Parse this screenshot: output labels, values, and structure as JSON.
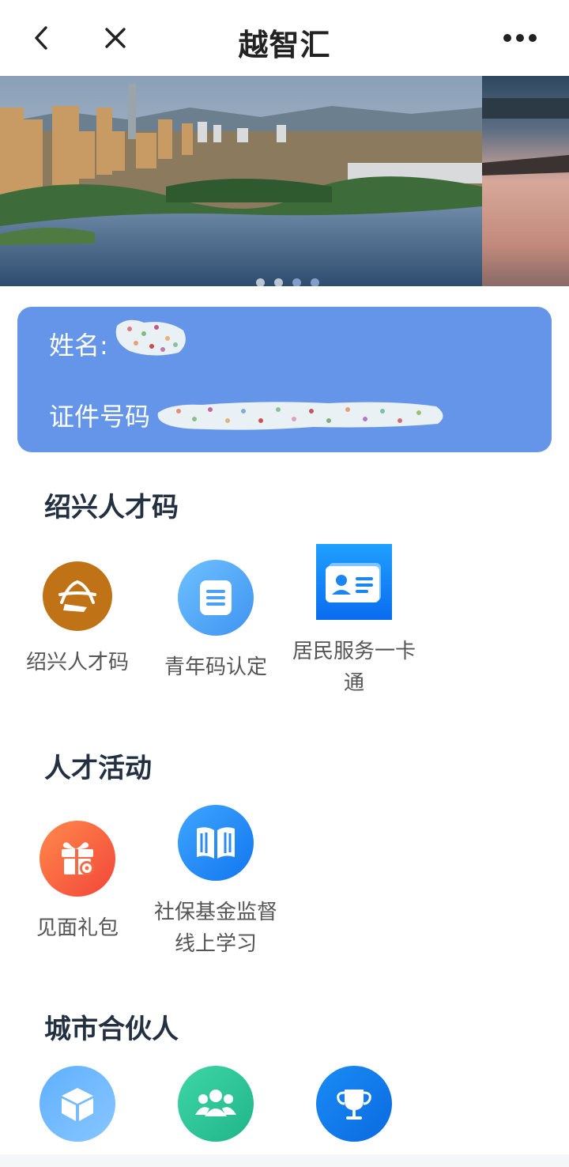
{
  "navbar": {
    "title": "越智汇",
    "back_icon": "chevron-left-icon",
    "close_icon": "close-icon",
    "more_icon": "more-horizontal-icon"
  },
  "banner": {
    "slides": [
      {
        "description_icon": "city-lake-photo"
      },
      {
        "description_icon": "lake-sunset-photo"
      }
    ],
    "dot_count": 4,
    "active_dot_index": 2
  },
  "id_card": {
    "name_label": "姓名:",
    "id_label": "证件号码",
    "background_color": "#6495e8"
  },
  "sections": [
    {
      "title": "绍兴人才码",
      "items": [
        {
          "label": "绍兴人才码",
          "icon": "talent-code-logo-icon"
        },
        {
          "label": "青年码认定",
          "icon": "document-icon"
        },
        {
          "label": "居民服务一卡通",
          "icon": "id-card-icon"
        }
      ]
    },
    {
      "title": "人才活动",
      "items": [
        {
          "label": "见面礼包",
          "icon": "gift-icon"
        },
        {
          "label": "社保基金监督线上学习",
          "icon": "book-icon"
        }
      ]
    },
    {
      "title": "城市合伙人",
      "items": [
        {
          "label": "",
          "icon": "cube-icon"
        },
        {
          "label": "",
          "icon": "group-icon"
        },
        {
          "label": "",
          "icon": "trophy-icon"
        }
      ]
    }
  ]
}
